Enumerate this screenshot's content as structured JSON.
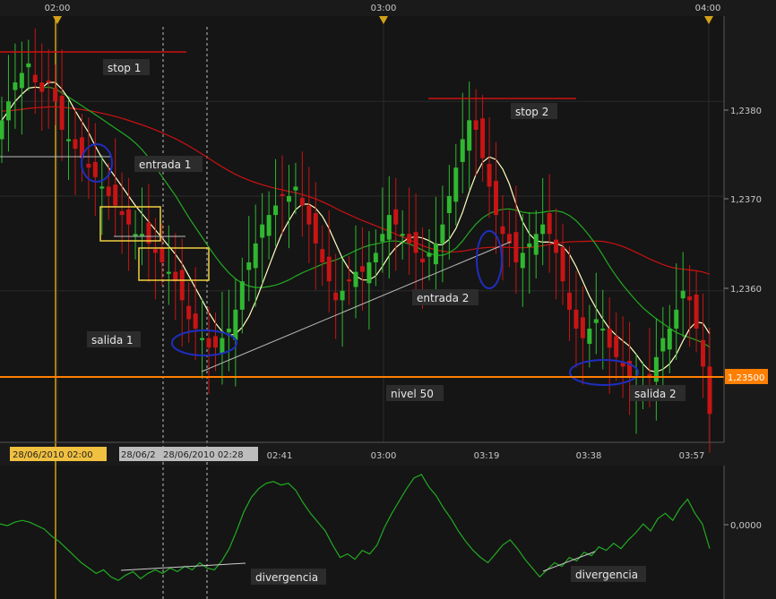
{
  "chart_data": [
    {
      "type": "candlestick",
      "title": "",
      "time_axis_top": [
        "02:00",
        "03:00",
        "04:00"
      ],
      "time_axis_bottom": [
        "02:41",
        "03:00",
        "03:19",
        "03:38",
        "03:57"
      ],
      "cursor_dates": [
        "28/06/2010 02:00",
        "28/06/2",
        "28/06/2010 02:28"
      ],
      "y_ticks": [
        "1,2380",
        "1,2370",
        "1,2360"
      ],
      "ylim": [
        1.2344,
        1.2389
      ],
      "highlighted_level": {
        "value": 1.235,
        "label": "1,23500",
        "color": "#ff7f00"
      },
      "annotations": {
        "stop_1": "stop 1",
        "entrada_1": "entrada 1",
        "salida_1": "salida 1",
        "stop_2": "stop 2",
        "entrada_2": "entrada 2",
        "nivel_50": "nivel 50",
        "salida_2": "salida 2"
      },
      "price_series": [
        1.2378,
        1.238,
        1.2382,
        1.2383,
        1.2384,
        1.2382,
        1.2381,
        1.2382,
        1.238,
        1.2377,
        1.2376,
        1.2375,
        1.2374,
        1.2373,
        1.2372,
        1.2371,
        1.237,
        1.2369,
        1.2368,
        1.2367,
        1.2366,
        1.2366,
        1.2365,
        1.2364,
        1.2363,
        1.2362,
        1.2361,
        1.2359,
        1.2357,
        1.2356,
        1.2355,
        1.2354,
        1.2354,
        1.2355,
        1.2356,
        1.2358,
        1.2361,
        1.2363,
        1.2365,
        1.2367,
        1.2368,
        1.2369,
        1.237,
        1.237,
        1.2371,
        1.2369,
        1.2367,
        1.2365,
        1.2363,
        1.2361,
        1.2359,
        1.236,
        1.2361,
        1.2362,
        1.2362,
        1.2363,
        1.2364,
        1.2366,
        1.2368,
        1.2367,
        1.2366,
        1.2365,
        1.2364,
        1.2363,
        1.2364,
        1.2365,
        1.2367,
        1.237,
        1.2373,
        1.2376,
        1.2378,
        1.2377,
        1.2374,
        1.2371,
        1.2368,
        1.2366,
        1.2365,
        1.2363,
        1.2364,
        1.2365,
        1.2366,
        1.2367,
        1.2366,
        1.2364,
        1.2361,
        1.2358,
        1.2356,
        1.2355,
        1.2356,
        1.2357,
        1.2356,
        1.2354,
        1.2353,
        1.2352,
        1.2351,
        1.235,
        1.235,
        1.2351,
        1.2353,
        1.2355,
        1.2356,
        1.2358,
        1.236,
        1.2359,
        1.2356,
        1.2352,
        1.2347
      ],
      "series": [
        {
          "name": "",
          "color": "#ffffc0",
          "kind": "moving-average"
        },
        {
          "name": "",
          "color": "#22aa22",
          "kind": "moving-average"
        },
        {
          "name": "",
          "color": "#cc1111",
          "kind": "moving-average"
        }
      ]
    },
    {
      "type": "line",
      "title": "",
      "y_ticks": [
        "0,0000"
      ],
      "annotations": {
        "divergencia_1": "divergencia",
        "divergencia_2": "divergencia"
      },
      "series": [
        {
          "name": "",
          "color": "#22aa22",
          "values": [
            0.6,
            0.5,
            0.7,
            0.8,
            0.7,
            0.5,
            0.3,
            -0.1,
            -0.4,
            -0.8,
            -1.2,
            -1.6,
            -1.9,
            -2.2,
            -2.0,
            -2.4,
            -2.6,
            -2.3,
            -2.1,
            -2.5,
            -2.2,
            -2.0,
            -2.2,
            -1.9,
            -2.1,
            -1.8,
            -2.0,
            -1.6,
            -1.9,
            -2.0,
            -1.5,
            -0.8,
            0.2,
            1.3,
            2.1,
            2.6,
            2.9,
            3.0,
            2.8,
            2.9,
            2.5,
            1.8,
            1.2,
            0.7,
            0.2,
            -0.6,
            -1.3,
            -1.1,
            -1.4,
            -0.9,
            -1.1,
            -0.6,
            0.4,
            1.2,
            1.9,
            2.6,
            3.2,
            3.4,
            2.7,
            2.2,
            1.5,
            0.9,
            0.2,
            -0.4,
            -0.9,
            -1.3,
            -1.6,
            -1.1,
            -0.6,
            -0.3,
            -0.8,
            -1.4,
            -1.9,
            -2.4,
            -2.0,
            -1.6,
            -1.8,
            -1.3,
            -1.5,
            -1.0,
            -1.2,
            -0.7,
            -0.9,
            -0.5,
            -0.8,
            -0.3,
            0.1,
            0.6,
            0.2,
            0.9,
            1.2,
            0.8,
            1.5,
            2.0,
            1.2,
            0.6,
            -0.8
          ]
        }
      ]
    }
  ]
}
